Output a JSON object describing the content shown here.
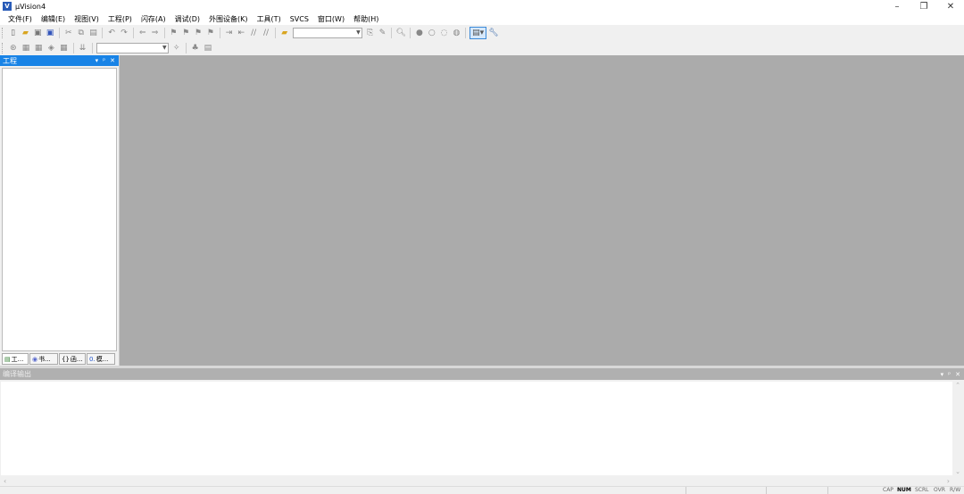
{
  "window": {
    "title": "µVision4",
    "minimize_label": "–",
    "maximize_label": "❐",
    "close_label": "✕"
  },
  "menu": [
    {
      "label": "文件(F)"
    },
    {
      "label": "编辑(E)"
    },
    {
      "label": "视图(V)"
    },
    {
      "label": "工程(P)"
    },
    {
      "label": "闪存(A)"
    },
    {
      "label": "调试(D)"
    },
    {
      "label": "外围设备(K)"
    },
    {
      "label": "工具(T)"
    },
    {
      "label": "SVCS"
    },
    {
      "label": "窗口(W)"
    },
    {
      "label": "帮助(H)"
    }
  ],
  "toolbar1": {
    "icons": [
      "new-file",
      "open-file",
      "save",
      "save-all",
      "cut",
      "copy",
      "paste",
      "undo",
      "redo",
      "nav-back",
      "nav-forward",
      "bookmark-toggle",
      "bookmark-prev",
      "bookmark-next",
      "bookmark-clear",
      "indent",
      "unindent",
      "comment",
      "uncomment",
      "find-in-files"
    ],
    "find_combo_value": "",
    "icons2": [
      "incremental-find",
      "find-replace",
      "debug-start",
      "breakpoint-insert",
      "breakpoint-disable",
      "breakpoint-disable-all",
      "breakpoint-kill-all",
      "window-layout",
      "configure"
    ]
  },
  "toolbar2": {
    "icons": [
      "translate",
      "build",
      "rebuild",
      "batch-build",
      "stop-build",
      "download"
    ],
    "target_combo_value": ""
  },
  "project_panel": {
    "title": "工程",
    "pin_label": "▾ ᵖ ✕",
    "tabs": [
      {
        "icon": "▤",
        "label": "工..."
      },
      {
        "icon": "◉",
        "label": "书..."
      },
      {
        "icon": "{}",
        "label": "函..."
      },
      {
        "icon": "0.",
        "label": "模..."
      }
    ]
  },
  "output_panel": {
    "title": "编译输出",
    "content": ""
  },
  "statusbar": {
    "indicators": [
      {
        "label": "CAP",
        "on": false
      },
      {
        "label": "NUM",
        "on": true
      },
      {
        "label": "SCRL",
        "on": false
      },
      {
        "label": "OVR",
        "on": false
      },
      {
        "label": "R/W",
        "on": false
      }
    ]
  }
}
